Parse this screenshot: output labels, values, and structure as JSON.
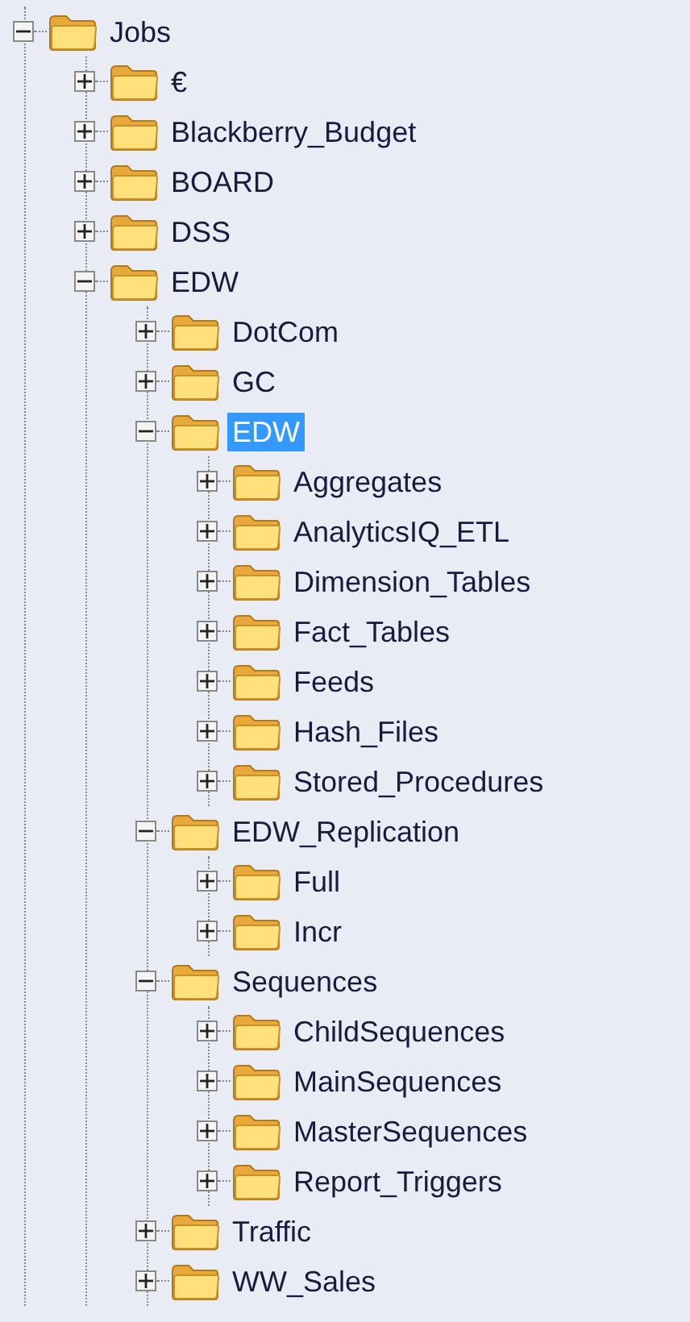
{
  "tree": [
    {
      "label": "Jobs",
      "expanded": true,
      "selected": false,
      "children": [
        {
          "label": "€",
          "expanded": false,
          "selected": false
        },
        {
          "label": "Blackberry_Budget",
          "expanded": false,
          "selected": false
        },
        {
          "label": "BOARD",
          "expanded": false,
          "selected": false
        },
        {
          "label": "DSS",
          "expanded": false,
          "selected": false
        },
        {
          "label": "EDW",
          "expanded": true,
          "selected": false,
          "children": [
            {
              "label": "DotCom",
              "expanded": false,
              "selected": false
            },
            {
              "label": "GC",
              "expanded": false,
              "selected": false
            },
            {
              "label": "EDW",
              "expanded": true,
              "selected": true,
              "children": [
                {
                  "label": "Aggregates",
                  "expanded": false,
                  "selected": false
                },
                {
                  "label": "AnalyticsIQ_ETL",
                  "expanded": false,
                  "selected": false
                },
                {
                  "label": "Dimension_Tables",
                  "expanded": false,
                  "selected": false
                },
                {
                  "label": "Fact_Tables",
                  "expanded": false,
                  "selected": false
                },
                {
                  "label": "Feeds",
                  "expanded": false,
                  "selected": false
                },
                {
                  "label": "Hash_Files",
                  "expanded": false,
                  "selected": false
                },
                {
                  "label": "Stored_Procedures",
                  "expanded": false,
                  "selected": false
                }
              ]
            },
            {
              "label": "EDW_Replication",
              "expanded": true,
              "selected": false,
              "children": [
                {
                  "label": "Full",
                  "expanded": false,
                  "selected": false
                },
                {
                  "label": "Incr",
                  "expanded": false,
                  "selected": false
                }
              ]
            },
            {
              "label": "Sequences",
              "expanded": true,
              "selected": false,
              "children": [
                {
                  "label": "ChildSequences",
                  "expanded": false,
                  "selected": false
                },
                {
                  "label": "MainSequences",
                  "expanded": false,
                  "selected": false
                },
                {
                  "label": "MasterSequences",
                  "expanded": false,
                  "selected": false
                },
                {
                  "label": "Report_Triggers",
                  "expanded": false,
                  "selected": false
                }
              ]
            },
            {
              "label": "Traffic",
              "expanded": false,
              "selected": false
            },
            {
              "label": "WW_Sales",
              "expanded": false,
              "selected": false
            }
          ]
        }
      ]
    }
  ]
}
